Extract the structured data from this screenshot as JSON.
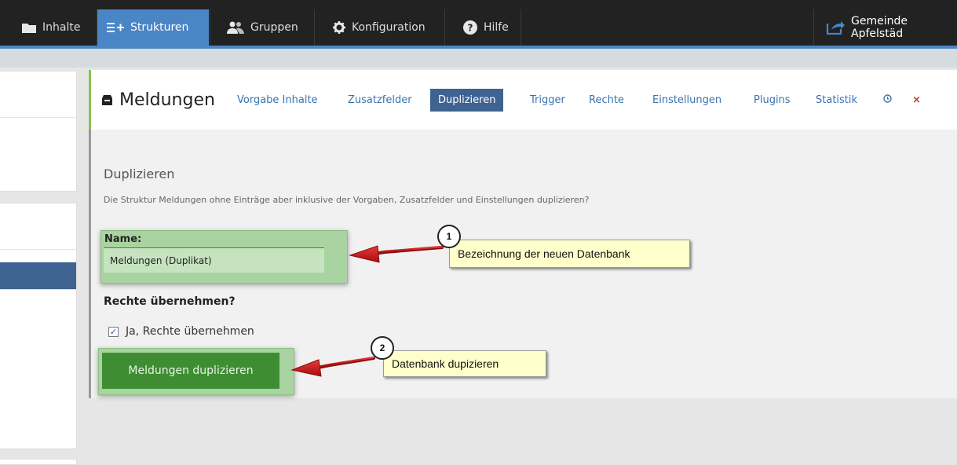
{
  "nav": {
    "items": [
      {
        "label": "Inhalte",
        "icon": "folder-icon"
      },
      {
        "label": "Strukturen",
        "icon": "structure-icon"
      },
      {
        "label": "Gruppen",
        "icon": "users-icon"
      },
      {
        "label": "Konfiguration",
        "icon": "gear-icon"
      },
      {
        "label": "Hilfe",
        "icon": "help-icon"
      }
    ],
    "site": {
      "label": "Gemeinde Apfelstäd",
      "icon": "external-link-icon"
    },
    "accent": "#4a86c5"
  },
  "header": {
    "title": "Meldungen",
    "title_icon": "inbox-icon",
    "tabs": [
      {
        "label": "Vorgabe Inhalte"
      },
      {
        "label": "Zusatzfelder"
      },
      {
        "label": "Duplizieren"
      },
      {
        "label": "Trigger"
      },
      {
        "label": "Rechte"
      },
      {
        "label": "Einstellungen"
      },
      {
        "label": "Plugins"
      },
      {
        "label": "Statistik"
      },
      {
        "icon": "clock-icon"
      },
      {
        "label": "×",
        "icon": "close-icon"
      }
    ],
    "active_tab": "Duplizieren"
  },
  "main": {
    "section_title": "Duplizieren",
    "description": "Die Struktur Meldungen ohne Einträge aber inklusive der Vorgaben, Zusatzfelder und Einstellungen duplizieren?",
    "name_label": "Name:",
    "name_value": "Meldungen (Duplikat)",
    "rights_title": "Rechte übernehmen?",
    "rights_checkbox_label": "Ja, Rechte übernehmen",
    "rights_checked": true,
    "submit_label": "Meldungen duplizieren"
  },
  "annotations": [
    {
      "number": "1",
      "text": "Bezeichnung der neuen Datenbank"
    },
    {
      "number": "2",
      "text": "Datenbank dupizieren"
    }
  ],
  "colors": {
    "button": "#3f8d33",
    "active_tab": "#3e6391",
    "highlight": "#a9d3a0",
    "callout": "#ffffcc",
    "arrow": "#cc1111"
  }
}
